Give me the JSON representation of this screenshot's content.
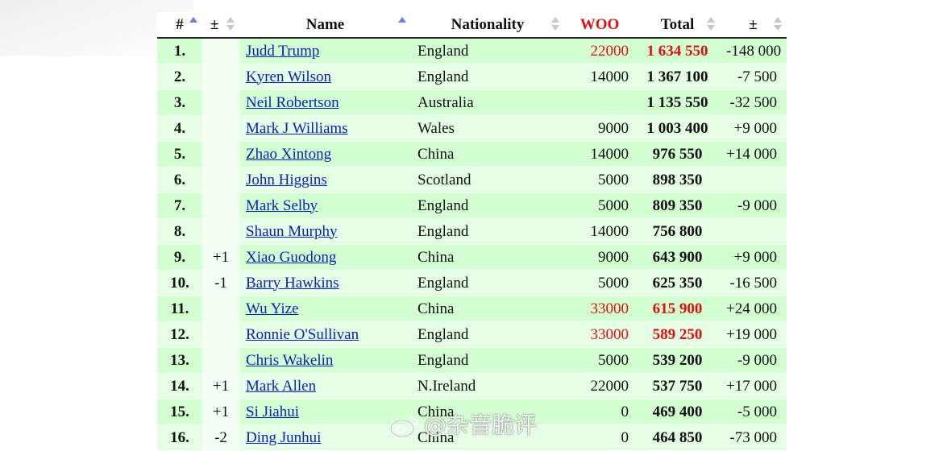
{
  "table": {
    "headers": {
      "rank": "#",
      "change": "±",
      "name": "Name",
      "nationality": "Nationality",
      "woo": "WOO",
      "total": "Total",
      "diff": "±"
    },
    "rows": [
      {
        "rank": "1.",
        "change": "",
        "name": "Judd Trump",
        "nationality": "England",
        "woo": "22000",
        "total": "1 634 550",
        "diff": "-148 000",
        "highlight": true
      },
      {
        "rank": "2.",
        "change": "",
        "name": "Kyren Wilson",
        "nationality": "England",
        "woo": "14000",
        "total": "1 367 100",
        "diff": "-7 500",
        "highlight": false
      },
      {
        "rank": "3.",
        "change": "",
        "name": "Neil Robertson",
        "nationality": "Australia",
        "woo": "",
        "total": "1 135 550",
        "diff": "-32 500",
        "highlight": false
      },
      {
        "rank": "4.",
        "change": "",
        "name": "Mark J Williams",
        "nationality": "Wales",
        "woo": "9000",
        "total": "1 003 400",
        "diff": "+9 000",
        "highlight": false
      },
      {
        "rank": "5.",
        "change": "",
        "name": "Zhao Xintong",
        "nationality": "China",
        "woo": "14000",
        "total": "976 550",
        "diff": "+14 000",
        "highlight": false
      },
      {
        "rank": "6.",
        "change": "",
        "name": "John Higgins",
        "nationality": "Scotland",
        "woo": "5000",
        "total": "898 350",
        "diff": "",
        "highlight": false
      },
      {
        "rank": "7.",
        "change": "",
        "name": "Mark Selby",
        "nationality": "England",
        "woo": "5000",
        "total": "809 350",
        "diff": "-9 000",
        "highlight": false
      },
      {
        "rank": "8.",
        "change": "",
        "name": "Shaun Murphy",
        "nationality": "England",
        "woo": "14000",
        "total": "756 800",
        "diff": "",
        "highlight": false
      },
      {
        "rank": "9.",
        "change": "+1",
        "name": "Xiao Guodong",
        "nationality": "China",
        "woo": "9000",
        "total": "643 900",
        "diff": "+9 000",
        "highlight": false
      },
      {
        "rank": "10.",
        "change": "-1",
        "name": "Barry Hawkins",
        "nationality": "England",
        "woo": "5000",
        "total": "625 350",
        "diff": "-16 500",
        "highlight": false
      },
      {
        "rank": "11.",
        "change": "",
        "name": "Wu Yize",
        "nationality": "China",
        "woo": "33000",
        "total": "615 900",
        "diff": "+24 000",
        "highlight": true
      },
      {
        "rank": "12.",
        "change": "",
        "name": "Ronnie O'Sullivan",
        "nationality": "England",
        "woo": "33000",
        "total": "589 250",
        "diff": "+19 000",
        "highlight": true
      },
      {
        "rank": "13.",
        "change": "",
        "name": "Chris Wakelin",
        "nationality": "England",
        "woo": "5000",
        "total": "539 200",
        "diff": "-9 000",
        "highlight": false
      },
      {
        "rank": "14.",
        "change": "+1",
        "name": "Mark Allen",
        "nationality": "N.Ireland",
        "woo": "22000",
        "total": "537 750",
        "diff": "+17 000",
        "highlight": false
      },
      {
        "rank": "15.",
        "change": "+1",
        "name": "Si Jiahui",
        "nationality": "China",
        "woo": "0",
        "total": "469 400",
        "diff": "-5 000",
        "highlight": false
      },
      {
        "rank": "16.",
        "change": "-2",
        "name": "Ding Junhui",
        "nationality": "China",
        "woo": "0",
        "total": "464 850",
        "diff": "-73 000",
        "highlight": false
      }
    ]
  },
  "watermark": {
    "text": "@杂音脆评"
  },
  "colors": {
    "accent_red": "#e01010",
    "link_blue": "#0b21b8",
    "row_green": "#d3ffd3",
    "row_green_alt": "#e6fde6"
  }
}
